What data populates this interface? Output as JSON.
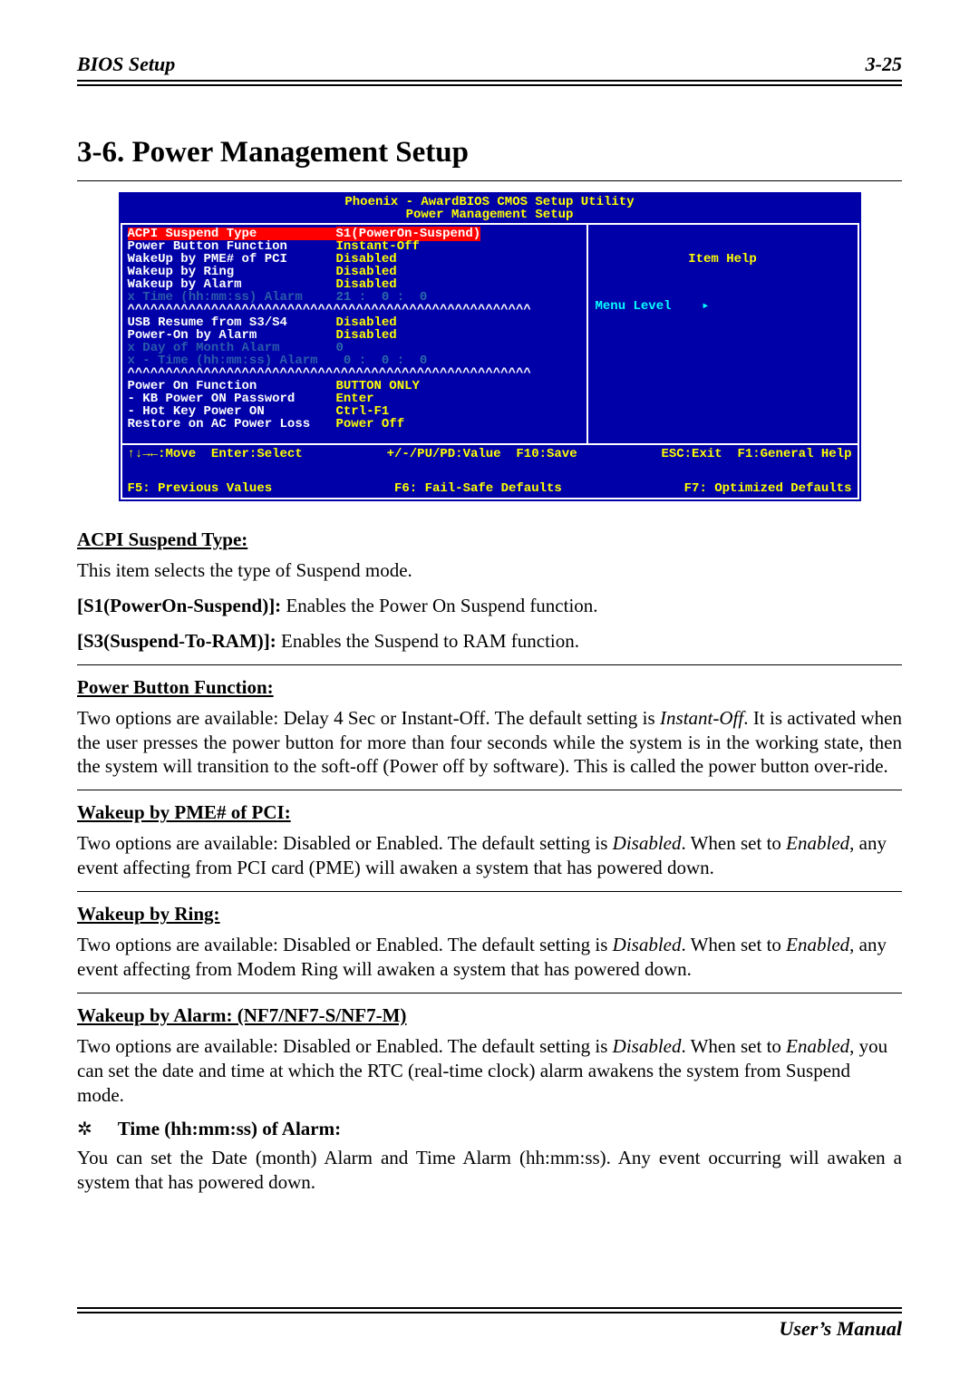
{
  "header": {
    "left": "BIOS Setup",
    "right": "3-25"
  },
  "section_title": "3-6.   Power Management Setup",
  "bios": {
    "title_line1": "Phoenix - AwardBIOS CMOS Setup Utility",
    "title_line2": "Power Management Setup",
    "help_title": "Item Help",
    "menu_level": "Menu Level    ▸",
    "rows": [
      {
        "label": "ACPI Suspend Type",
        "value": "S1(PowerOn-Suspend)",
        "style": "sel"
      },
      {
        "label": "Power Button Function",
        "value": "Instant-Off"
      },
      {
        "label": "WakeUp by PME# of PCI",
        "value": "Disabled"
      },
      {
        "label": "Wakeup by Ring",
        "value": "Disabled"
      },
      {
        "label": "Wakeup by Alarm",
        "value": "Disabled"
      },
      {
        "label": "x Time (hh:mm:ss) Alarm",
        "value": "21 :  0 :  0",
        "style": "dim"
      },
      {
        "sep": "^^^^^^^^^^^^^^^^^^^^^^^^^^^^^^^^^^^^^^^^^^^^^^^^^^^^^"
      },
      {
        "label": "USB Resume from S3/S4",
        "value": "Disabled"
      },
      {
        "label": "Power-On by Alarm",
        "value": "Disabled"
      },
      {
        "label": "x Day of Month Alarm",
        "value": "0",
        "style": "dim"
      },
      {
        "label": "x - Time (hh:mm:ss) Alarm",
        "value": " 0 :  0 :  0",
        "style": "dim"
      },
      {
        "sep": "^^^^^^^^^^^^^^^^^^^^^^^^^^^^^^^^^^^^^^^^^^^^^^^^^^^^^"
      },
      {
        "label": "Power On Function",
        "value": "BUTTON ONLY"
      },
      {
        "label": "- KB Power ON Password",
        "value": "Enter"
      },
      {
        "label": "- Hot Key Power ON",
        "value": "Ctrl-F1"
      },
      {
        "label": "Restore on AC Power Loss",
        "value": "Power Off"
      }
    ],
    "foot": {
      "c1": "↑↓→←:Move  Enter:Select",
      "c2": "+/-/PU/PD:Value  F10:Save",
      "c3": "ESC:Exit  F1:General Help",
      "c4": "F5: Previous Values",
      "c5": "F6: Fail-Safe Defaults",
      "c6": "F7: Optimized Defaults"
    }
  },
  "sections": {
    "acpi": {
      "head": "ACPI Suspend Type:",
      "intro": "This item selects the type of Suspend mode.",
      "opt1_label": "[S1(PowerOn-Suspend)]:",
      "opt1_text": " Enables the Power On Suspend function.",
      "opt2_label": "[S3(Suspend-To-RAM)]:",
      "opt2_text": " Enables the Suspend to RAM function."
    },
    "pbf": {
      "head": "Power Button Function:",
      "p1a": "Two options are available: Delay 4 Sec or Instant-Off. The default setting is ",
      "p1i": "Instant-Off",
      "p1b": ". It is activated when the user presses the power button for more than four seconds while the system is in the working state, then the system will transition to the soft-off (Power off by software). This is called the power button over-ride."
    },
    "pme": {
      "head": "Wakeup by PME# of PCI:",
      "p1a": "Two options are available: Disabled or Enabled. The default setting is ",
      "p1i1": "Disabled",
      "p1b": ". When set to ",
      "p1i2": "Enabled",
      "p1c": ", any event affecting from PCI card (PME) will awaken a system that has powered down."
    },
    "ring": {
      "head": "Wakeup by Ring:",
      "p1a": "Two options are available: Disabled or Enabled. The default setting is ",
      "p1i1": "Disabled",
      "p1b": ". When set to ",
      "p1i2": "Enabled",
      "p1c": ", any event affecting from Modem Ring will awaken a system that has powered down."
    },
    "alarm": {
      "head": "Wakeup by Alarm: (NF7/NF7-S/NF7-M)",
      "p1a": "Two options are available: Disabled or Enabled. The default setting is ",
      "p1i1": "Disabled",
      "p1b": ". When set to ",
      "p1i2": "Enabled",
      "p1c": ", you can set the date and time at which the RTC (real-time clock) alarm awakens the system from Suspend mode.",
      "bullet_glyph": "✲",
      "bullet_label": "Time (hh:mm:ss) of Alarm:",
      "p2": "You can set the Date (month) Alarm and Time Alarm (hh:mm:ss). Any event occurring will awaken a system that has powered down."
    }
  },
  "footer": "User’s Manual"
}
